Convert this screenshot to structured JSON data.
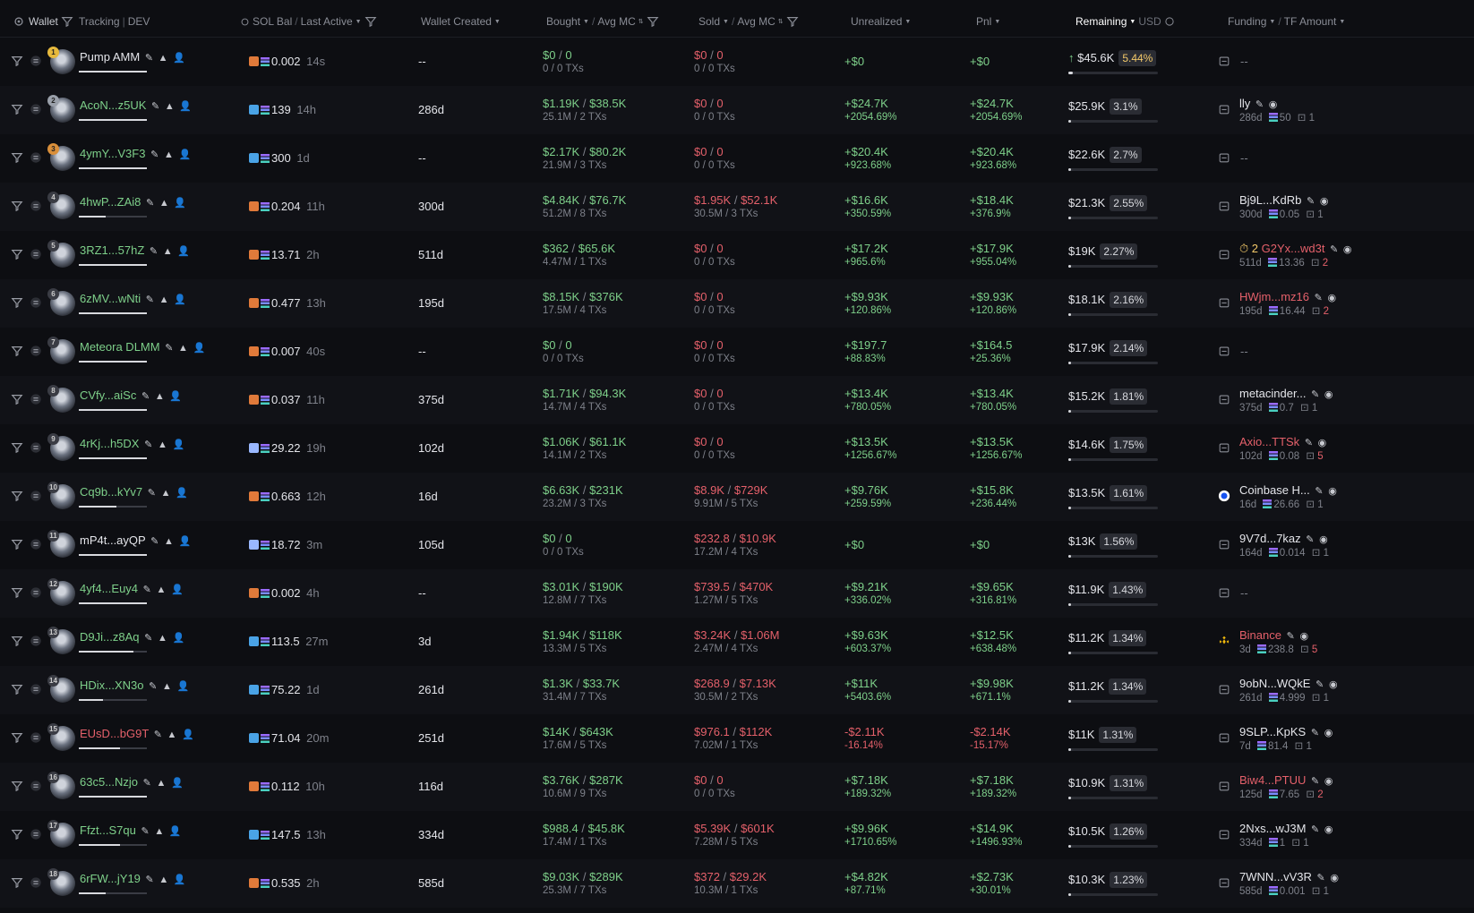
{
  "header": {
    "wallet": "Wallet",
    "tracking": "Tracking",
    "dev": "DEV",
    "sol_bal": "SOL Bal",
    "last_active": "Last Active",
    "wallet_created": "Wallet Created",
    "bought": "Bought",
    "avg_mc": "Avg MC",
    "sold": "Sold",
    "avg_mc_sold": "Avg MC",
    "unrealized": "Unrealized",
    "pnl": "Pnl",
    "remaining": "Remaining",
    "usd": "USD",
    "funding": "Funding",
    "tf_amount": "TF Amount"
  },
  "rows": [
    {
      "rank": "1",
      "name": "Pump AMM",
      "name_color": "white",
      "bal": "0.002",
      "bal_icon": "orange",
      "last": "14s",
      "created": "--",
      "b_usd": "$0",
      "b_mc": "0",
      "b_sub": "0 / 0 TXs",
      "b_red": false,
      "s_usd": "$0",
      "s_mc": "0",
      "s_sub": "0 / 0 TXs",
      "u1": "+$0",
      "u2": "",
      "u_red": false,
      "p1": "+$0",
      "p2": "",
      "p_red": false,
      "rem": "$45.6K",
      "rem_pct": "5.44%",
      "rem_fill": 0.05,
      "fund": "--",
      "fund_color": "dim",
      "fund_age": "",
      "fund_amt": "",
      "fund_tx": "",
      "fund_tx_red": false,
      "arrow": true
    },
    {
      "rank": "2",
      "name": "AcoN...z5UK",
      "name_color": "green",
      "bal": "139",
      "bal_icon": "blue",
      "last": "14h",
      "created": "286d",
      "b_usd": "$1.19K",
      "b_mc": "$38.5K",
      "b_sub": "25.1M / 2 TXs",
      "s_usd": "$0",
      "s_mc": "0",
      "s_sub": "0 / 0 TXs",
      "u1": "+$24.7K",
      "u2": "+2054.69%",
      "u_red": false,
      "p1": "+$24.7K",
      "p2": "+2054.69%",
      "p_red": false,
      "rem": "$25.9K",
      "rem_pct": "3.1%",
      "rem_fill": 0.03,
      "fund": "lly",
      "fund_color": "white",
      "fund_age": "286d",
      "fund_amt": "50",
      "fund_tx": "1",
      "fund_tx_red": false
    },
    {
      "rank": "3",
      "name": "4ymY...V3F3",
      "name_color": "green",
      "bal": "300",
      "bal_icon": "blue",
      "last": "1d",
      "created": "--",
      "b_usd": "$2.17K",
      "b_mc": "$80.2K",
      "b_sub": "21.9M / 3 TXs",
      "s_usd": "$0",
      "s_mc": "0",
      "s_sub": "0 / 0 TXs",
      "u1": "+$20.4K",
      "u2": "+923.68%",
      "u_red": false,
      "p1": "+$20.4K",
      "p2": "+923.68%",
      "p_red": false,
      "rem": "$22.6K",
      "rem_pct": "2.7%",
      "rem_fill": 0.03,
      "fund": "--",
      "fund_color": "dim",
      "fund_age": "",
      "fund_amt": "",
      "fund_tx": "",
      "fund_tx_red": false
    },
    {
      "rank": "4",
      "name": "4hwP...ZAi8",
      "name_color": "green",
      "bal": "0.204",
      "bal_icon": "orange",
      "last": "11h",
      "created": "300d",
      "b_usd": "$4.84K",
      "b_mc": "$76.7K",
      "b_sub": "51.2M / 8 TXs",
      "s_usd": "$1.95K",
      "s_mc": "$52.1K",
      "s_sub": "30.5M / 3 TXs",
      "u1": "+$16.6K",
      "u2": "+350.59%",
      "u_red": false,
      "p1": "+$18.4K",
      "p2": "+376.9%",
      "p_red": false,
      "rem": "$21.3K",
      "rem_pct": "2.55%",
      "rem_fill": 0.03,
      "fund": "Bj9L...KdRb",
      "fund_color": "white",
      "fund_age": "300d",
      "fund_amt": "0.05",
      "fund_tx": "1",
      "fund_tx_red": false
    },
    {
      "rank": "5",
      "name": "3RZ1...57hZ",
      "name_color": "green",
      "bal": "13.71",
      "bal_icon": "orange",
      "last": "2h",
      "created": "511d",
      "b_usd": "$362",
      "b_mc": "$65.6K",
      "b_sub": "4.47M / 1 TXs",
      "s_usd": "$0",
      "s_mc": "0",
      "s_sub": "0 / 0 TXs",
      "u1": "+$17.2K",
      "u2": "+965.6%",
      "u_red": false,
      "p1": "+$17.9K",
      "p2": "+955.04%",
      "p_red": false,
      "rem": "$19K",
      "rem_pct": "2.27%",
      "rem_fill": 0.03,
      "fund": "G2Yx...wd3t",
      "fund_color": "red",
      "fund_prefix": "2",
      "fund_age": "511d",
      "fund_amt": "13.36",
      "fund_tx": "2",
      "fund_tx_red": true
    },
    {
      "rank": "6",
      "name": "6zMV...wNti",
      "name_color": "green",
      "bal": "0.477",
      "bal_icon": "orange",
      "last": "13h",
      "created": "195d",
      "b_usd": "$8.15K",
      "b_mc": "$376K",
      "b_sub": "17.5M / 4 TXs",
      "s_usd": "$0",
      "s_mc": "0",
      "s_sub": "0 / 0 TXs",
      "u1": "+$9.93K",
      "u2": "+120.86%",
      "u_red": false,
      "p1": "+$9.93K",
      "p2": "+120.86%",
      "p_red": false,
      "rem": "$18.1K",
      "rem_pct": "2.16%",
      "rem_fill": 0.03,
      "fund": "HWjm...mz16",
      "fund_color": "red",
      "fund_age": "195d",
      "fund_amt": "16.44",
      "fund_tx": "2",
      "fund_tx_red": true
    },
    {
      "rank": "7",
      "name": "Meteora DLMM",
      "name_color": "green",
      "bal": "0.007",
      "bal_icon": "orange",
      "last": "40s",
      "created": "--",
      "b_usd": "$0",
      "b_mc": "0",
      "b_sub": "0 / 0 TXs",
      "s_usd": "$0",
      "s_mc": "0",
      "s_sub": "0 / 0 TXs",
      "u1": "+$197.7",
      "u2": "+88.83%",
      "u_red": false,
      "p1": "+$164.5",
      "p2": "+25.36%",
      "p_red": false,
      "rem": "$17.9K",
      "rem_pct": "2.14%",
      "rem_fill": 0.03,
      "fund": "--",
      "fund_color": "dim",
      "fund_age": "",
      "fund_amt": "",
      "fund_tx": "",
      "fund_tx_red": false
    },
    {
      "rank": "8",
      "name": "CVfy...aiSc",
      "name_color": "green",
      "bal": "0.037",
      "bal_icon": "orange",
      "last": "11h",
      "created": "375d",
      "b_usd": "$1.71K",
      "b_mc": "$94.3K",
      "b_sub": "14.7M / 4 TXs",
      "s_usd": "$0",
      "s_mc": "0",
      "s_sub": "0 / 0 TXs",
      "u1": "+$13.4K",
      "u2": "+780.05%",
      "u_red": false,
      "p1": "+$13.4K",
      "p2": "+780.05%",
      "p_red": false,
      "rem": "$15.2K",
      "rem_pct": "1.81%",
      "rem_fill": 0.02,
      "fund": "metacinder...",
      "fund_color": "white",
      "fund_age": "375d",
      "fund_amt": "0.7",
      "fund_tx": "1",
      "fund_tx_red": false
    },
    {
      "rank": "9",
      "name": "4rKj...h5DX",
      "name_color": "green",
      "bal": "29.22",
      "bal_icon": "eye",
      "last": "19h",
      "created": "102d",
      "b_usd": "$1.06K",
      "b_mc": "$61.1K",
      "b_sub": "14.1M / 2 TXs",
      "s_usd": "$0",
      "s_mc": "0",
      "s_sub": "0 / 0 TXs",
      "u1": "+$13.5K",
      "u2": "+1256.67%",
      "u_red": false,
      "p1": "+$13.5K",
      "p2": "+1256.67%",
      "p_red": false,
      "rem": "$14.6K",
      "rem_pct": "1.75%",
      "rem_fill": 0.02,
      "fund": "Axio...TTSk",
      "fund_color": "red",
      "fund_age": "102d",
      "fund_amt": "0.08",
      "fund_tx": "5",
      "fund_tx_red": true
    },
    {
      "rank": "10",
      "name": "Cq9b...kYv7",
      "name_color": "green",
      "bal": "0.663",
      "bal_icon": "orange",
      "last": "12h",
      "created": "16d",
      "b_usd": "$6.63K",
      "b_mc": "$231K",
      "b_sub": "23.2M / 3 TXs",
      "s_usd": "$8.9K",
      "s_mc": "$729K",
      "s_sub": "9.91M / 5 TXs",
      "u1": "+$9.76K",
      "u2": "+259.59%",
      "u_red": false,
      "p1": "+$15.8K",
      "p2": "+236.44%",
      "p_red": false,
      "rem": "$13.5K",
      "rem_pct": "1.61%",
      "rem_fill": 0.02,
      "fund": "Coinbase H...",
      "fund_color": "white",
      "fund_icon": "coinbase",
      "fund_age": "16d",
      "fund_amt": "26.66",
      "fund_tx": "1",
      "fund_tx_red": false
    },
    {
      "rank": "11",
      "name": "mP4t...ayQP",
      "name_color": "white",
      "bal": "18.72",
      "bal_icon": "eye",
      "last": "3m",
      "created": "105d",
      "b_usd": "$0",
      "b_mc": "0",
      "b_sub": "0 / 0 TXs",
      "s_usd": "$232.8",
      "s_mc": "$10.9K",
      "s_sub": "17.2M / 4 TXs",
      "u1": "+$0",
      "u2": "",
      "u_red": false,
      "p1": "+$0",
      "p2": "",
      "p_red": false,
      "rem": "$13K",
      "rem_pct": "1.56%",
      "rem_fill": 0.02,
      "fund": "9V7d...7kaz",
      "fund_color": "white",
      "fund_age": "164d",
      "fund_amt": "0.014",
      "fund_tx": "1",
      "fund_tx_red": false
    },
    {
      "rank": "12",
      "name": "4yf4...Euy4",
      "name_color": "green",
      "bal": "0.002",
      "bal_icon": "orange",
      "last": "4h",
      "created": "--",
      "b_usd": "$3.01K",
      "b_mc": "$190K",
      "b_sub": "12.8M / 7 TXs",
      "s_usd": "$739.5",
      "s_mc": "$470K",
      "s_sub": "1.27M / 5 TXs",
      "u1": "+$9.21K",
      "u2": "+336.02%",
      "u_red": false,
      "p1": "+$9.65K",
      "p2": "+316.81%",
      "p_red": false,
      "rem": "$11.9K",
      "rem_pct": "1.43%",
      "rem_fill": 0.02,
      "fund": "--",
      "fund_color": "dim",
      "fund_age": "",
      "fund_amt": "",
      "fund_tx": "",
      "fund_tx_red": false
    },
    {
      "rank": "13",
      "name": "D9Ji...z8Aq",
      "name_color": "green",
      "bal": "113.5",
      "bal_icon": "blue",
      "last": "27m",
      "created": "3d",
      "b_usd": "$1.94K",
      "b_mc": "$118K",
      "b_sub": "13.3M / 5 TXs",
      "s_usd": "$3.24K",
      "s_mc": "$1.06M",
      "s_sub": "2.47M / 4 TXs",
      "u1": "+$9.63K",
      "u2": "+603.37%",
      "u_red": false,
      "p1": "+$12.5K",
      "p2": "+638.48%",
      "p_red": false,
      "rem": "$11.2K",
      "rem_pct": "1.34%",
      "rem_fill": 0.02,
      "fund": "Binance",
      "fund_color": "red",
      "fund_icon": "binance",
      "fund_age": "3d",
      "fund_amt": "238.8",
      "fund_tx": "5",
      "fund_tx_red": true
    },
    {
      "rank": "14",
      "name": "HDix...XN3o",
      "name_color": "green",
      "bal": "75.22",
      "bal_icon": "blue",
      "last": "1d",
      "created": "261d",
      "b_usd": "$1.3K",
      "b_mc": "$33.7K",
      "b_sub": "31.4M / 7 TXs",
      "s_usd": "$268.9",
      "s_mc": "$7.13K",
      "s_sub": "30.5M / 2 TXs",
      "u1": "+$11K",
      "u2": "+5403.6%",
      "u_red": false,
      "p1": "+$9.98K",
      "p2": "+671.1%",
      "p_red": false,
      "rem": "$11.2K",
      "rem_pct": "1.34%",
      "rem_fill": 0.02,
      "fund": "9obN...WQkE",
      "fund_color": "white",
      "fund_age": "261d",
      "fund_amt": "4.999",
      "fund_tx": "1",
      "fund_tx_red": false
    },
    {
      "rank": "15",
      "name": "EUsD...bG9T",
      "name_color": "red",
      "bal": "71.04",
      "bal_icon": "blue",
      "last": "20m",
      "created": "251d",
      "b_usd": "$14K",
      "b_mc": "$643K",
      "b_sub": "17.6M / 5 TXs",
      "s_usd": "$976.1",
      "s_mc": "$112K",
      "s_sub": "7.02M / 1 TXs",
      "u1": "-$2.11K",
      "u2": "-16.14%",
      "u_red": true,
      "p1": "-$2.14K",
      "p2": "-15.17%",
      "p_red": true,
      "rem": "$11K",
      "rem_pct": "1.31%",
      "rem_fill": 0.02,
      "fund": "9SLP...KpKS",
      "fund_color": "white",
      "fund_age": "7d",
      "fund_amt": "81.4",
      "fund_tx": "1",
      "fund_tx_red": false
    },
    {
      "rank": "16",
      "name": "63c5...Nzjo",
      "name_color": "green",
      "bal": "0.112",
      "bal_icon": "orange",
      "last": "10h",
      "created": "116d",
      "b_usd": "$3.76K",
      "b_mc": "$287K",
      "b_sub": "10.6M / 9 TXs",
      "s_usd": "$0",
      "s_mc": "0",
      "s_sub": "0 / 0 TXs",
      "u1": "+$7.18K",
      "u2": "+189.32%",
      "u_red": false,
      "p1": "+$7.18K",
      "p2": "+189.32%",
      "p_red": false,
      "rem": "$10.9K",
      "rem_pct": "1.31%",
      "rem_fill": 0.02,
      "fund": "Biw4...PTUU",
      "fund_color": "red",
      "fund_age": "125d",
      "fund_amt": "7.65",
      "fund_tx": "2",
      "fund_tx_red": true
    },
    {
      "rank": "17",
      "name": "Ffzt...S7qu",
      "name_color": "green",
      "bal": "147.5",
      "bal_icon": "blue",
      "last": "13h",
      "created": "334d",
      "b_usd": "$988.4",
      "b_mc": "$45.8K",
      "b_sub": "17.4M / 1 TXs",
      "s_usd": "$5.39K",
      "s_mc": "$601K",
      "s_sub": "7.28M / 5 TXs",
      "u1": "+$9.96K",
      "u2": "+1710.65%",
      "u_red": false,
      "p1": "+$14.9K",
      "p2": "+1496.93%",
      "p_red": false,
      "rem": "$10.5K",
      "rem_pct": "1.26%",
      "rem_fill": 0.02,
      "fund": "2Nxs...wJ3M",
      "fund_color": "white",
      "fund_age": "334d",
      "fund_amt": "1",
      "fund_tx": "1",
      "fund_tx_red": false
    },
    {
      "rank": "18",
      "name": "6rFW...jY19",
      "name_color": "green",
      "bal": "0.535",
      "bal_icon": "orange",
      "last": "2h",
      "created": "585d",
      "b_usd": "$9.03K",
      "b_mc": "$289K",
      "b_sub": "25.3M / 7 TXs",
      "s_usd": "$372",
      "s_mc": "$29.2K",
      "s_sub": "10.3M / 1 TXs",
      "u1": "+$4.82K",
      "u2": "+87.71%",
      "u_red": false,
      "p1": "+$2.73K",
      "p2": "+30.01%",
      "p_red": false,
      "rem": "$10.3K",
      "rem_pct": "1.23%",
      "rem_fill": 0.02,
      "fund": "7WNN...vV3R",
      "fund_color": "white",
      "fund_age": "585d",
      "fund_amt": "0.001",
      "fund_tx": "1",
      "fund_tx_red": false
    }
  ],
  "colors": {
    "green": "#7ed08a",
    "red": "#e4606a",
    "bg": "#0d0e12",
    "row_alt": "#111217"
  }
}
